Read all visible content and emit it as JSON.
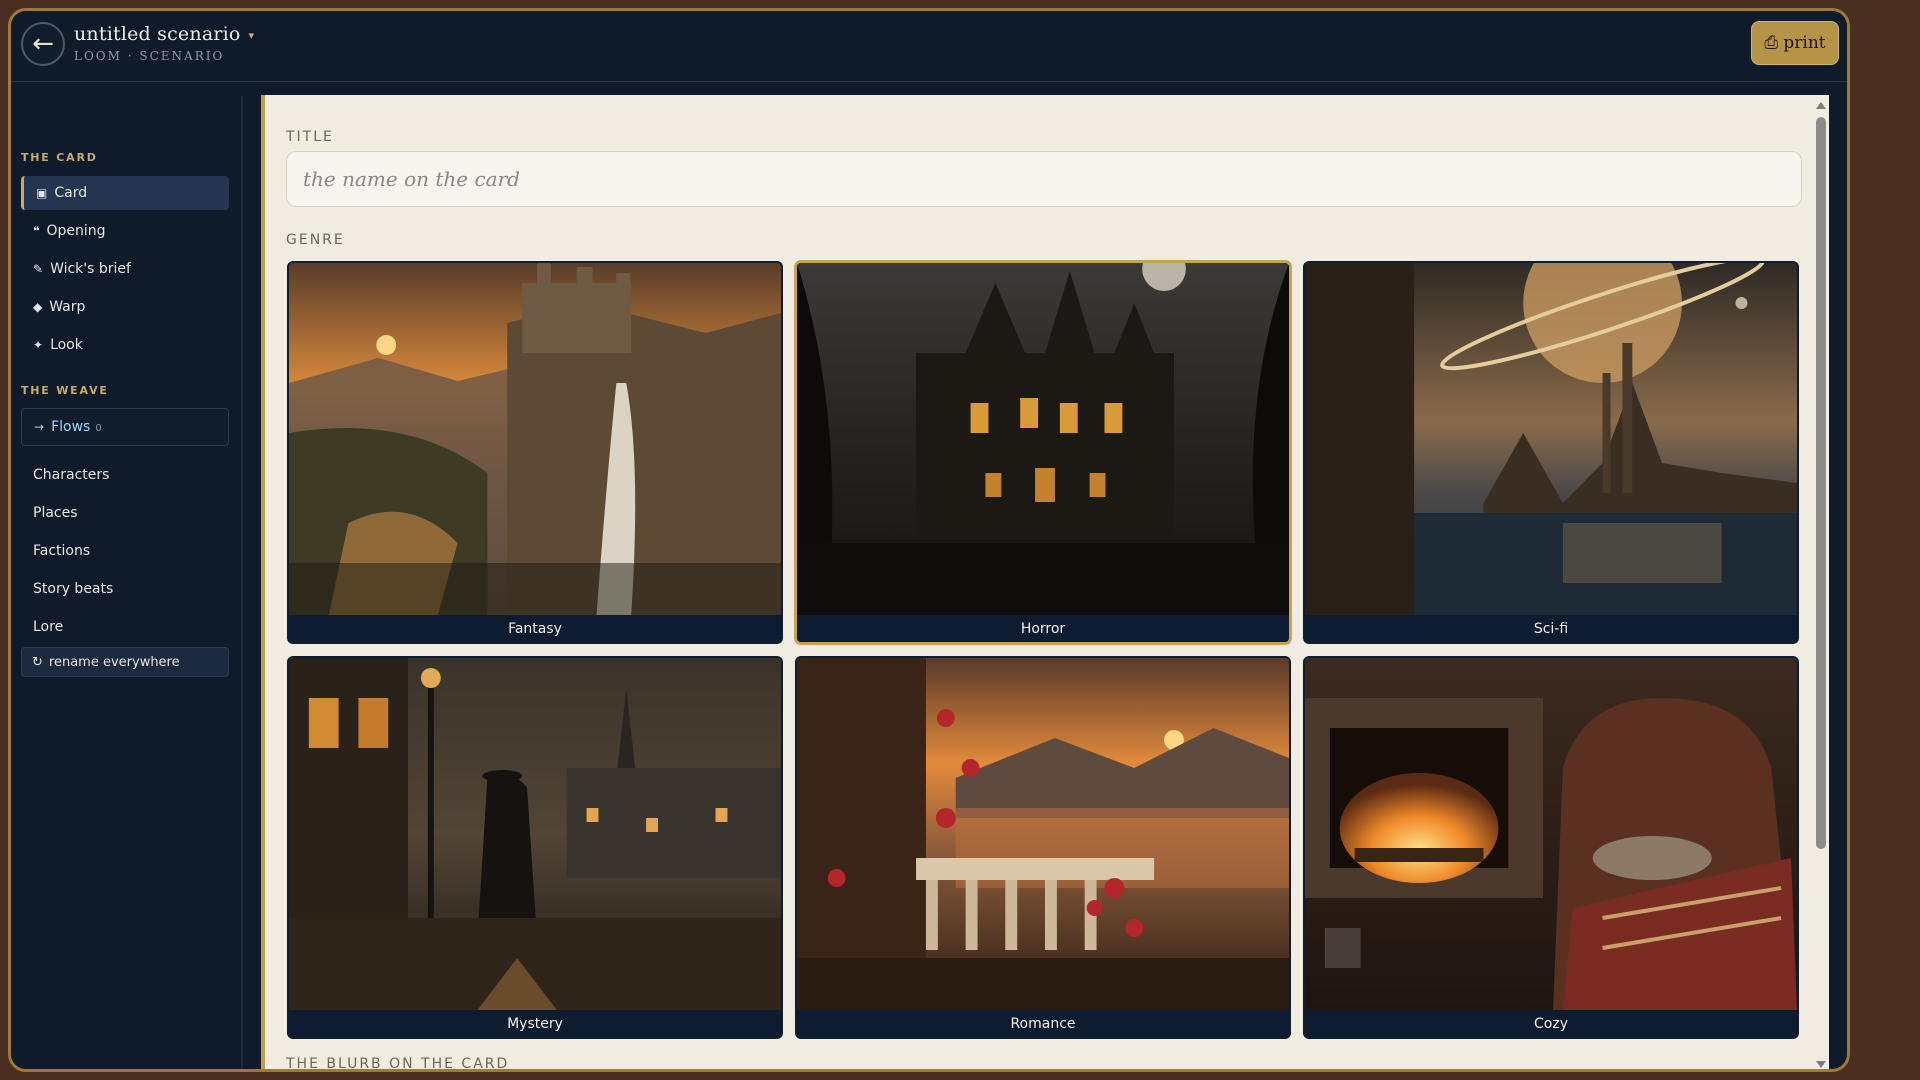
{
  "app": {
    "back_icon": "←",
    "title": "untitled scenario",
    "title_caret": "▾",
    "subtitle": "LOOM · SCENARIO",
    "print_label": "⎙ print"
  },
  "sidebar": {
    "section_card": "THE CARD",
    "card_items": [
      {
        "glyph": "▣",
        "label": "Card",
        "icon": "card-icon"
      },
      {
        "glyph": "❝",
        "label": "Opening",
        "icon": "quote-icon"
      },
      {
        "glyph": "✎",
        "label": "Wick's brief",
        "icon": "pen-icon"
      },
      {
        "glyph": "◆",
        "label": "Warp",
        "icon": "diamond-icon"
      },
      {
        "glyph": "✦",
        "label": "Look",
        "icon": "sparkle-icon"
      }
    ],
    "section_weave": "THE WEAVE",
    "flows": {
      "glyph": "→",
      "label": "Flows",
      "count": "0"
    },
    "weave_items": [
      "Characters",
      "Places",
      "Factions",
      "Story beats",
      "Lore"
    ],
    "rename": {
      "glyph": "↻",
      "label": "rename everywhere"
    }
  },
  "main": {
    "title_label": "TITLE",
    "title_placeholder": "the name on the card",
    "genre_label": "GENRE",
    "genres": [
      "Fantasy",
      "Horror",
      "Sci-fi",
      "Mystery",
      "Romance",
      "Cozy"
    ],
    "selected_genre": "Horror",
    "blurb_label": "THE BLURB ON THE CARD"
  },
  "colors": {
    "frame": "#0f1b2b",
    "accent": "#c9a34f",
    "content_bg": "#f1ece1",
    "outer_bg": "#4a2e1f"
  }
}
